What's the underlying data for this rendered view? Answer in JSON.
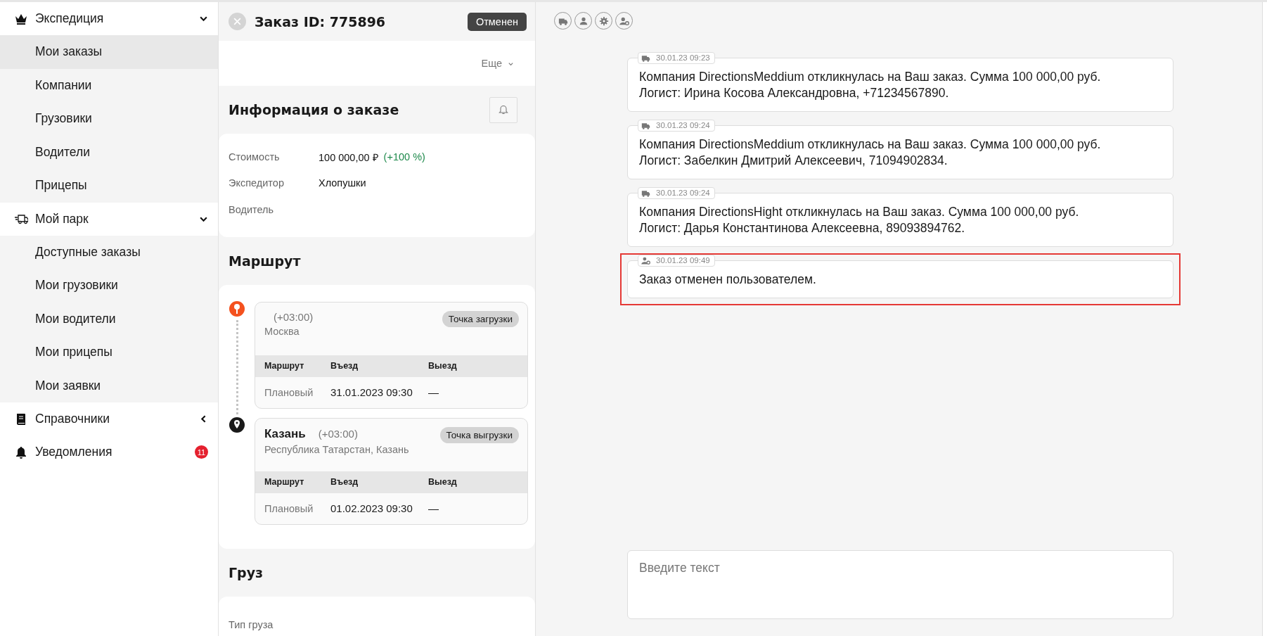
{
  "sidebar": {
    "groups": [
      {
        "kind": "group",
        "label": "Экспедиция",
        "expanded": true,
        "items": [
          {
            "label": "Мои заказы",
            "selected": true
          },
          {
            "label": "Компании",
            "selected": false
          },
          {
            "label": "Грузовики",
            "selected": false
          },
          {
            "label": "Водители",
            "selected": false
          },
          {
            "label": "Прицепы",
            "selected": false
          }
        ]
      },
      {
        "kind": "group",
        "label": "Мой парк",
        "expanded": true,
        "items": [
          {
            "label": "Доступные заказы",
            "selected": false
          },
          {
            "label": "Мои грузовики",
            "selected": false
          },
          {
            "label": "Мои водители",
            "selected": false
          },
          {
            "label": "Мои прицепы",
            "selected": false
          },
          {
            "label": "Мои заявки",
            "selected": false
          }
        ]
      },
      {
        "kind": "group",
        "label": "Справочники",
        "expanded": false
      },
      {
        "kind": "link",
        "label": "Уведомления",
        "badge": "11"
      }
    ]
  },
  "order": {
    "title": "Заказ ID: 775896",
    "status": "Отменен",
    "more": "Еще",
    "info": {
      "title": "Информация о заказе",
      "fields": [
        {
          "label": "Стоимость",
          "value": "100 000,00 ₽",
          "change": "(+100 %)"
        },
        {
          "label": "Экспедитор",
          "value": "Хлопушки"
        },
        {
          "label": "Водитель"
        }
      ]
    },
    "route": {
      "title": "Маршрут",
      "stops": [
        {
          "kind": "loading",
          "timezone": "(+03:00)",
          "address": "Москва",
          "tag": "Точка загрузки",
          "columns": [
            "Маршрут",
            "Въезд",
            "Выезд"
          ],
          "row": [
            "Плановый",
            "31.01.2023 09:30",
            "—"
          ]
        },
        {
          "kind": "unloading",
          "city": "Казань",
          "timezone": "(+03:00)",
          "address": "Республика Татарстан, Казань",
          "tag": "Точка выгрузки",
          "columns": [
            "Маршрут",
            "Въезд",
            "Выезд"
          ],
          "row": [
            "Плановый",
            "01.02.2023 09:30",
            "—"
          ]
        }
      ]
    },
    "cargo": {
      "title": "Груз",
      "fields": [
        {
          "label": "Тип груза"
        }
      ]
    }
  },
  "chat": {
    "messages": [
      {
        "kind": "company",
        "time": "30.01.23 09:23",
        "text": "Компания DirectionsMeddium откликнулась на Ваш заказ. Сумма 100 000,00 руб.\nЛогист: Ирина Косова Александровна, +71234567890.",
        "highlighted": false
      },
      {
        "kind": "company",
        "time": "30.01.23 09:24",
        "text": "Компания DirectionsMeddium откликнулась на Ваш заказ. Сумма 100 000,00 руб.\nЛогист: Забелкин Дмитрий Алексеевич, 71094902834.",
        "highlighted": false
      },
      {
        "kind": "company",
        "time": "30.01.23 09:24",
        "text": "Компания DirectionsHight откликнулась на Ваш заказ. Сумма 100 000,00 руб.\nЛогист: Дарья Константинова Алексеевна, 89093894762.",
        "highlighted": false
      },
      {
        "kind": "system",
        "time": "30.01.23 09:49",
        "text": "Заказ отменен пользователем.",
        "highlighted": true
      }
    ],
    "input": {
      "placeholder": "Введите текст"
    }
  }
}
